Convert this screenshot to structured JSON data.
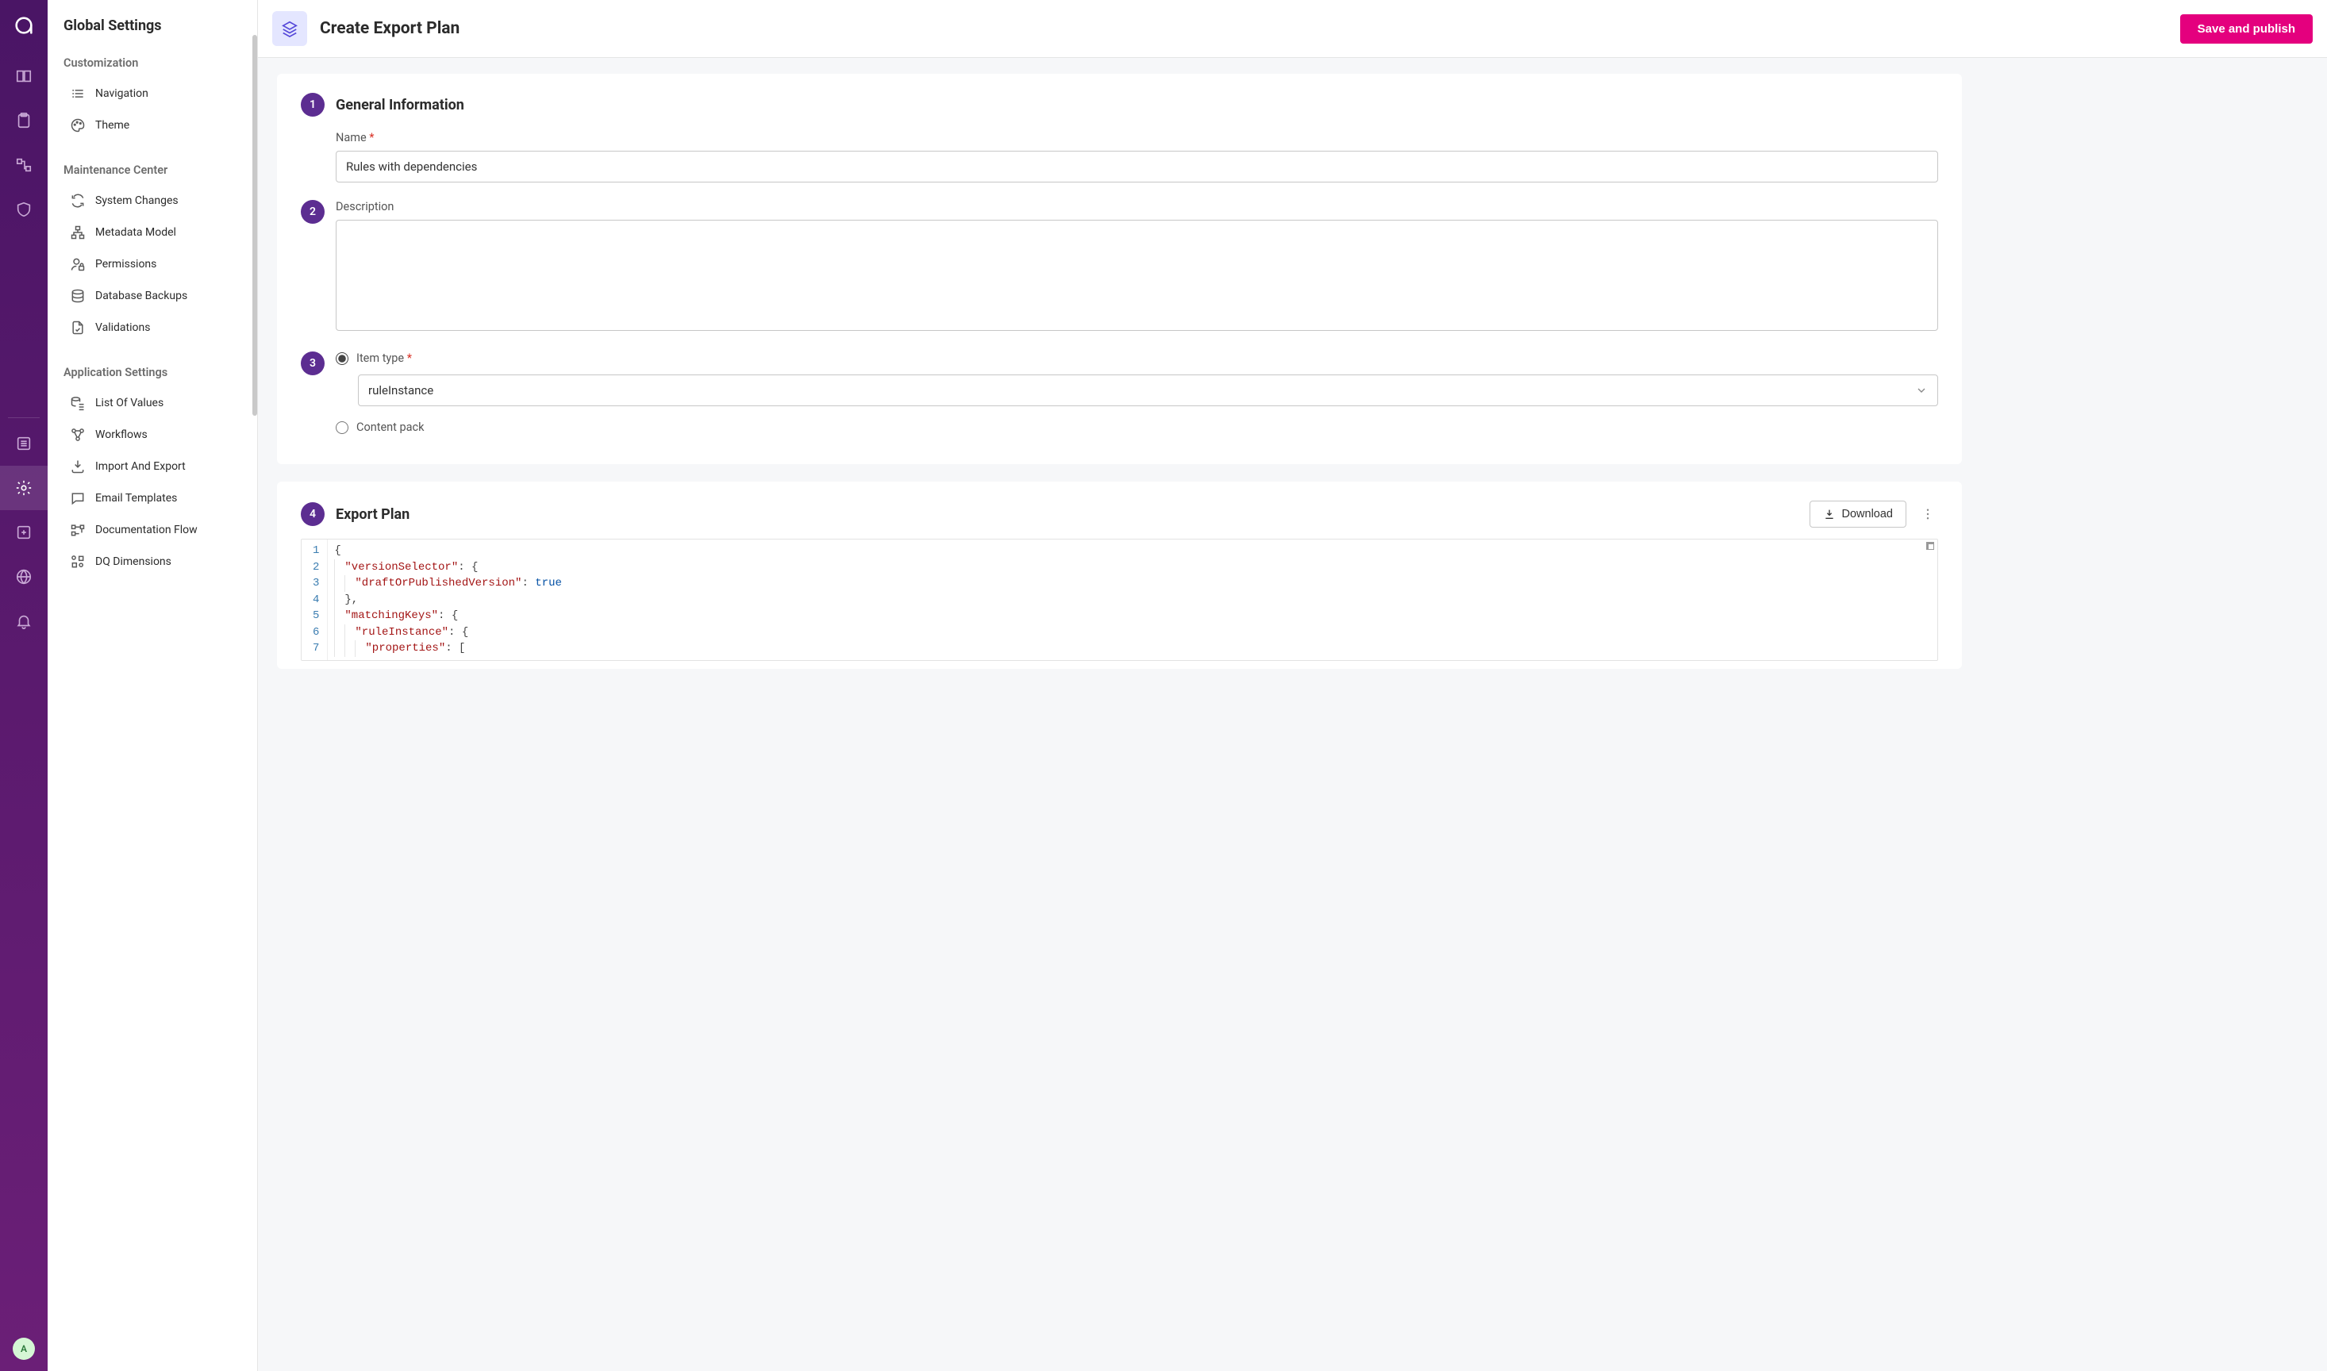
{
  "brand": {
    "logo_letter": "a"
  },
  "rail": {
    "avatar_letter": "A"
  },
  "sidebar": {
    "title": "Global Settings",
    "groups": [
      {
        "label": "Customization",
        "items": [
          {
            "label": "Navigation"
          },
          {
            "label": "Theme"
          }
        ]
      },
      {
        "label": "Maintenance Center",
        "items": [
          {
            "label": "System Changes"
          },
          {
            "label": "Metadata Model"
          },
          {
            "label": "Permissions"
          },
          {
            "label": "Database Backups"
          },
          {
            "label": "Validations"
          }
        ]
      },
      {
        "label": "Application Settings",
        "items": [
          {
            "label": "List Of Values"
          },
          {
            "label": "Workflows"
          },
          {
            "label": "Import And Export"
          },
          {
            "label": "Email Templates"
          },
          {
            "label": "Documentation Flow"
          },
          {
            "label": "DQ Dimensions"
          }
        ]
      }
    ]
  },
  "topbar": {
    "title": "Create Export Plan",
    "save_button": "Save and publish"
  },
  "steps": {
    "s1": "1",
    "s2": "2",
    "s3": "3",
    "s4": "4"
  },
  "form": {
    "section1_title": "General Information",
    "name_label": "Name",
    "name_value": "Rules with dependencies",
    "description_label": "Description",
    "description_value": "",
    "item_type_label": "Item type",
    "item_type_value": "ruleInstance",
    "content_pack_label": "Content pack",
    "section2_title": "Export Plan",
    "download_label": "Download"
  },
  "asterisk": "*",
  "code": {
    "lines": [
      {
        "n": "1",
        "indent": 0,
        "raw_brace": "{"
      },
      {
        "n": "2",
        "indent": 1,
        "key": "\"versionSelector\"",
        "after": ": {"
      },
      {
        "n": "3",
        "indent": 2,
        "key": "\"draftOrPublishedVersion\"",
        "after_colon": ": ",
        "bool": "true"
      },
      {
        "n": "4",
        "indent": 1,
        "raw_brace": "},"
      },
      {
        "n": "5",
        "indent": 1,
        "key": "\"matchingKeys\"",
        "after": ": {"
      },
      {
        "n": "6",
        "indent": 2,
        "key": "\"ruleInstance\"",
        "after": ": {"
      },
      {
        "n": "7",
        "indent": 3,
        "key": "\"properties\"",
        "after": ": ["
      }
    ]
  }
}
